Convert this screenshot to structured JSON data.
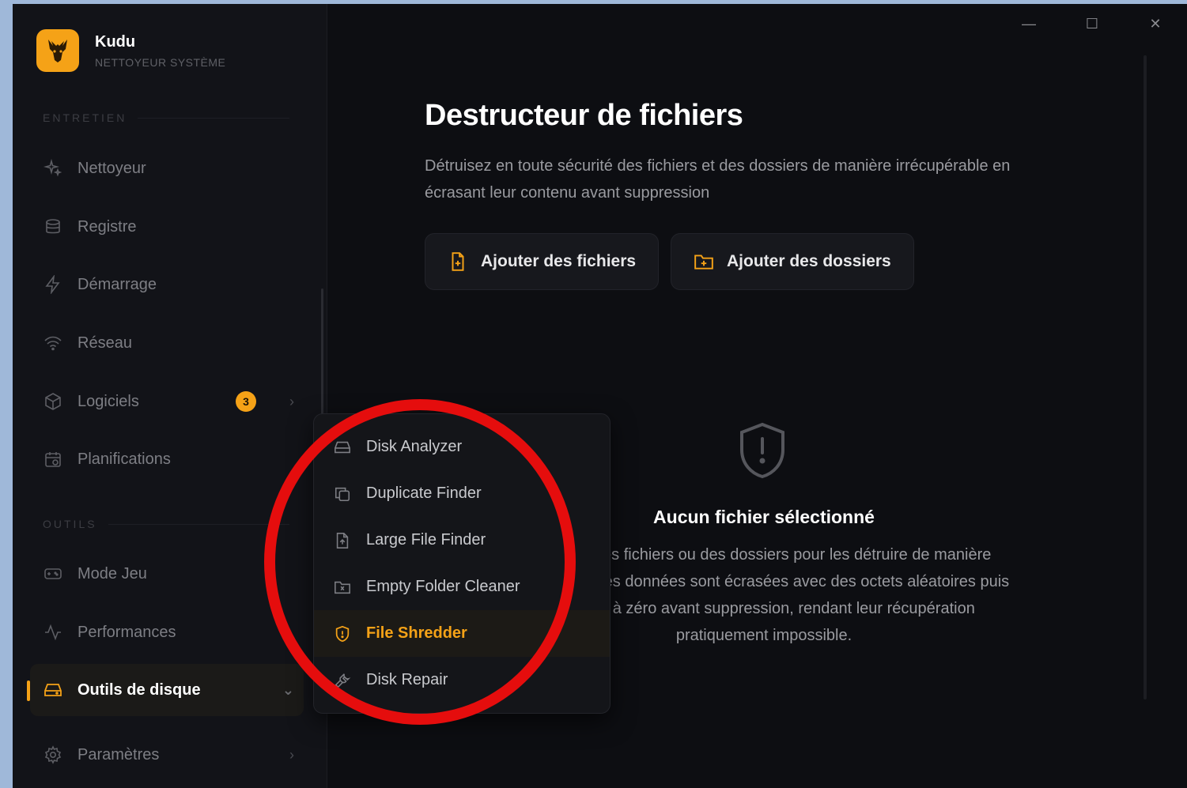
{
  "app": {
    "name": "Kudu",
    "subtitle": "NETTOYEUR SYSTÈME"
  },
  "colors": {
    "accent": "#f5a217",
    "background": "#0d0e12",
    "sidebar": "#121318",
    "annotation": "#e50d0d"
  },
  "sidebar": {
    "section_maintenance": "ENTRETIEN",
    "section_tools": "OUTILS",
    "items": [
      {
        "label": "Nettoyeur",
        "icon": "sparkle-icon"
      },
      {
        "label": "Registre",
        "icon": "database-icon"
      },
      {
        "label": "Démarrage",
        "icon": "bolt-icon"
      },
      {
        "label": "Réseau",
        "icon": "wifi-icon"
      },
      {
        "label": "Logiciels",
        "icon": "package-icon",
        "badge": "3"
      },
      {
        "label": "Planifications",
        "icon": "calendar-icon"
      },
      {
        "label": "Mode Jeu",
        "icon": "gamepad-icon"
      },
      {
        "label": "Performances",
        "icon": "pulse-icon"
      },
      {
        "label": "Outils de disque",
        "icon": "hard-drive-icon"
      },
      {
        "label": "Paramètres",
        "icon": "gear-icon"
      }
    ]
  },
  "window_controls": {
    "minimize": "—",
    "maximize": "☐",
    "close": "✕"
  },
  "main": {
    "title": "Destructeur de fichiers",
    "description": "Détruisez en toute sécurité des fichiers et des dossiers de manière irrécupérable en écrasant leur contenu avant suppression",
    "add_files_label": "Ajouter des fichiers",
    "add_folders_label": "Ajouter des dossiers",
    "empty_title": "Aucun fichier sélectionné",
    "empty_description": "Ajoutez des fichiers ou des dossiers pour les détruire de manière sécurisée. Les données sont écrasées avec des octets aléatoires puis remises à zéro avant suppression, rendant leur récupération pratiquement impossible."
  },
  "disk_tools_menu": {
    "items": [
      {
        "label": "Disk Analyzer",
        "icon": "hard-drive-icon"
      },
      {
        "label": "Duplicate Finder",
        "icon": "copy-icon"
      },
      {
        "label": "Large File Finder",
        "icon": "file-icon"
      },
      {
        "label": "Empty Folder Cleaner",
        "icon": "folder-x-icon"
      },
      {
        "label": "File Shredder",
        "icon": "shield-icon",
        "selected": true
      },
      {
        "label": "Disk Repair",
        "icon": "wrench-icon"
      }
    ]
  }
}
